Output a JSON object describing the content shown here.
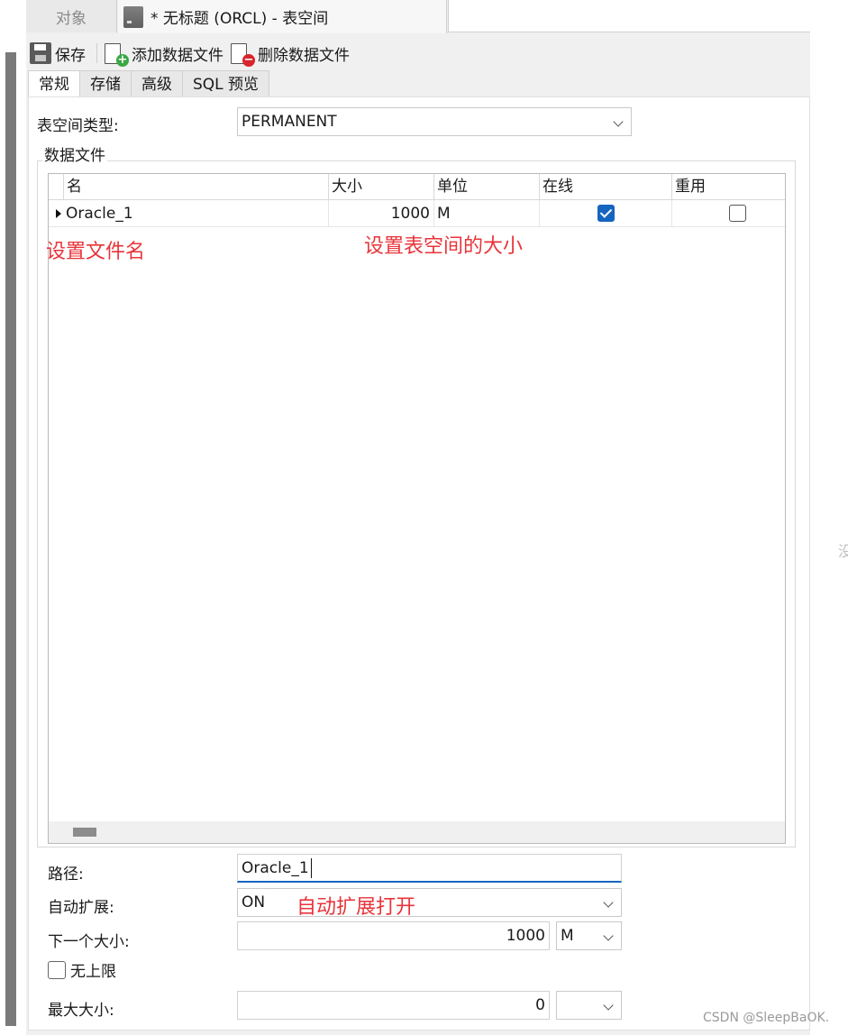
{
  "tabs": {
    "object_tab": "对象",
    "document_tab": "* 无标题 (ORCL) - 表空间"
  },
  "toolbar": {
    "save": "保存",
    "add_datafile": "添加数据文件",
    "delete_datafile": "删除数据文件"
  },
  "subtabs": [
    "常规",
    "存储",
    "高级",
    "SQL 预览"
  ],
  "form": {
    "tablespace_type_label": "表空间类型:",
    "tablespace_type_value": "PERMANENT",
    "datafiles_group": "数据文件"
  },
  "grid": {
    "headers": [
      "名",
      "大小",
      "单位",
      "在线",
      "重用"
    ],
    "rows": [
      {
        "name": "Oracle_1",
        "size": "1000",
        "unit": "M",
        "online": true,
        "reuse": false
      }
    ]
  },
  "annotations": {
    "filename": "设置文件名",
    "size": "设置表空间的大小",
    "autoextend": "自动扩展打开"
  },
  "details": {
    "path_label": "路径:",
    "path_value": "Oracle_1",
    "autoextend_label": "自动扩展:",
    "autoextend_value": "ON",
    "next_size_label": "下一个大小:",
    "next_size_value": "1000",
    "next_size_unit": "M",
    "unlimited_label": "无上限",
    "max_size_label": "最大大小:",
    "max_size_value": "0",
    "max_size_unit": ""
  },
  "watermark": "CSDN @SleepBaOK.",
  "edge_char": "没",
  "colors": {
    "accent": "#1565c0",
    "annotation": "#e8343a"
  }
}
